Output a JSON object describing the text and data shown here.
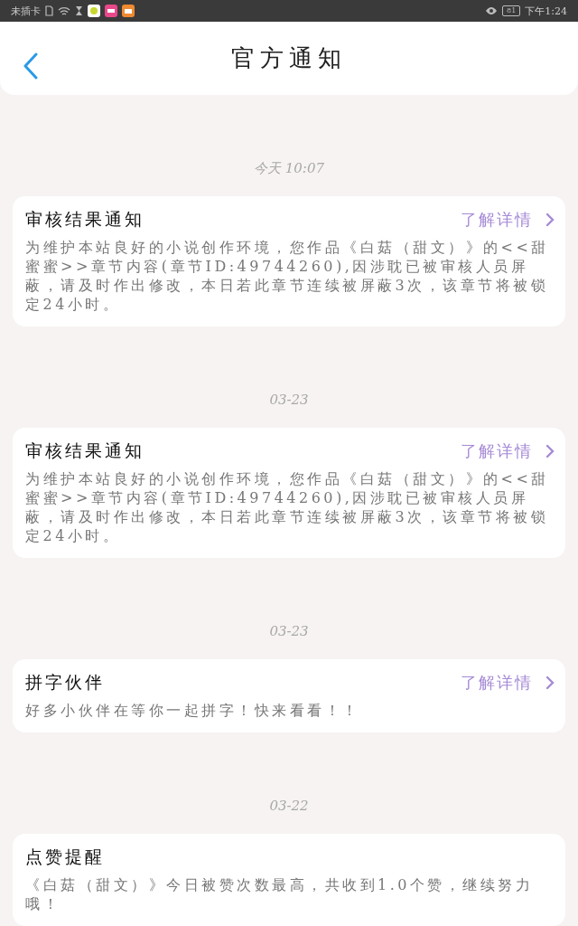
{
  "status_bar": {
    "carrier": "未插卡",
    "battery": "81",
    "time": "下午1:24"
  },
  "header": {
    "title": "官方通知"
  },
  "notices": [
    {
      "date": "今天 10:07",
      "title": "审核结果通知",
      "link": "了解详情",
      "body": "为维护本站良好的小说创作环境，您作品《白菇（甜文）》的<<甜蜜蜜>>章节内容(章节ID:49744260),因涉耽已被审核人员屏蔽，请及时作出修改，本日若此章节连续被屏蔽3次，该章节将被锁定24小时。"
    },
    {
      "date": "03-23",
      "title": "审核结果通知",
      "link": "了解详情",
      "body": "为维护本站良好的小说创作环境，您作品《白菇（甜文）》的<<甜蜜蜜>>章节内容(章节ID:49744260),因涉耽已被审核人员屏蔽，请及时作出修改，本日若此章节连续被屏蔽3次，该章节将被锁定24小时。"
    },
    {
      "date": "03-23",
      "title": "拼字伙伴",
      "link": "了解详情",
      "body": "好多小伙伴在等你一起拼字！快来看看！！"
    },
    {
      "date": "03-22",
      "title": "点赞提醒",
      "body": "《白菇（甜文）》今日被赞次数最高，共收到1.0个赞，继续努力哦！"
    }
  ]
}
